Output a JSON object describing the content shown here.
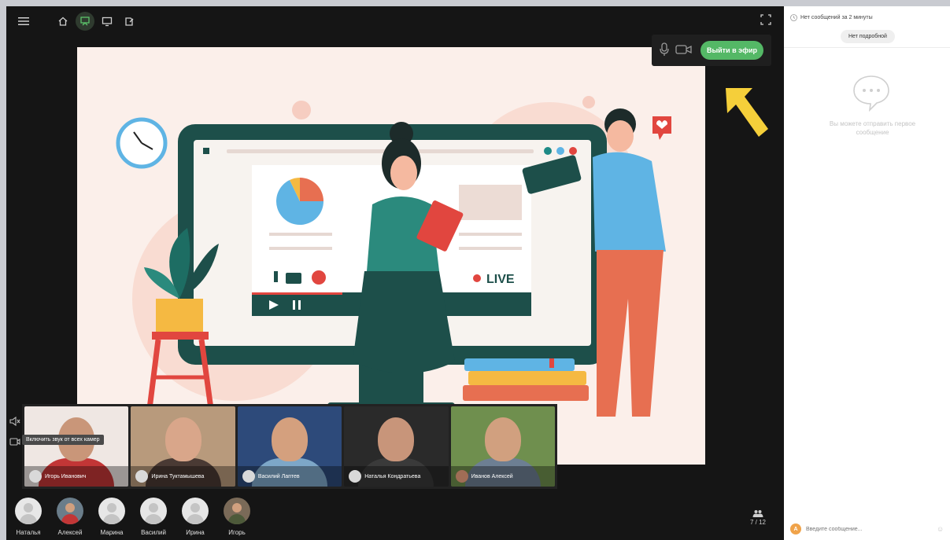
{
  "topbar": {
    "icons": [
      "menu-icon",
      "home-icon",
      "presenter-icon",
      "screen-share-icon",
      "whiteboard-icon",
      "fullscreen-icon"
    ]
  },
  "stage": {
    "live_label": "LIVE"
  },
  "broadcast": {
    "go_live_label": "Выйти в эфир"
  },
  "camera_tooltip": "Включить звук от всех камер",
  "cameras": [
    {
      "name": "Игорь Иванович"
    },
    {
      "name": "Ирина Туктамышева"
    },
    {
      "name": "Василий Лаптев"
    },
    {
      "name": "Наталья Кондратьева"
    },
    {
      "name": "Иванов Алексей"
    }
  ],
  "participants": [
    {
      "name": "Наталья"
    },
    {
      "name": "Алексей"
    },
    {
      "name": "Марина"
    },
    {
      "name": "Василий"
    },
    {
      "name": "Ирина"
    },
    {
      "name": "Игорь"
    }
  ],
  "participant_count": "7 / 12",
  "chat": {
    "status": "Нет сообщений за 2 минуты",
    "chip": "Нет подробной",
    "empty_text": "Вы можете отправить первое сообщение",
    "input_placeholder": "Введите сообщение...",
    "avatar_letter": "А"
  },
  "colors": {
    "accent_green": "#54b866",
    "arrow_yellow": "#f5cf3a",
    "stage_bg": "#fbefea"
  }
}
